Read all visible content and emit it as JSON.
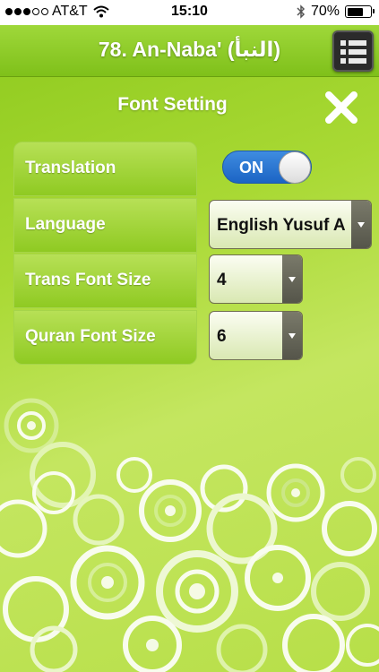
{
  "status_bar": {
    "carrier": "AT&T",
    "time": "15:10",
    "battery": "70%"
  },
  "header": {
    "title": "78. An-Naba' (النبأ)",
    "menu_icon": "list-menu-icon"
  },
  "settings": {
    "title": "Font Setting",
    "close_icon": "close-x-icon",
    "rows": [
      {
        "label": "Translation",
        "control": "toggle",
        "value": "ON"
      },
      {
        "label": "Language",
        "control": "select",
        "value": "English Yusuf A"
      },
      {
        "label": "Trans Font Size",
        "control": "select",
        "value": "4"
      },
      {
        "label": "Quran Font Size",
        "control": "select",
        "value": "6"
      }
    ]
  },
  "colors": {
    "background_green": "#9bd12a",
    "toggle_blue": "#2a74d4",
    "menu_dark": "#2b2b2b"
  }
}
